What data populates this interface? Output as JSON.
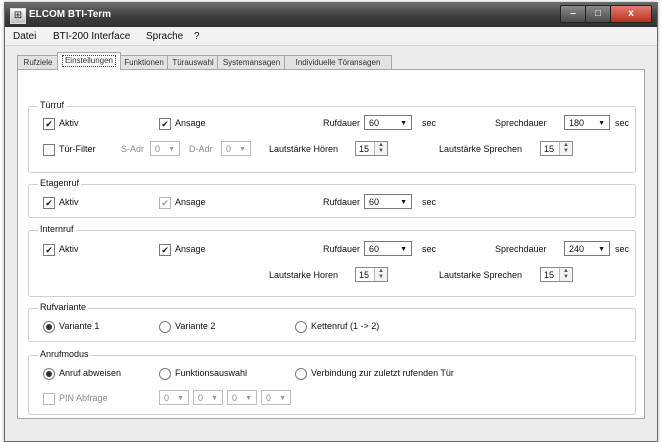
{
  "window": {
    "title": "ELCOM BTI-Term",
    "minimize": "–",
    "maximize": "□",
    "close": "x"
  },
  "menu": [
    "Datei",
    "BTI-200 Interface",
    "Sprache",
    "?"
  ],
  "tabs": [
    "Rufziele",
    "Einstellungen",
    "Funktionen",
    "Türauswahl",
    "Systemansagen",
    "Individuelle Töransagen"
  ],
  "active_tab": "Einstellungen",
  "tuerruf": {
    "title": "Türruf",
    "aktiv": "Aktiv",
    "ansage": "Ansage",
    "rufdauer_label": "Rufdauer",
    "rufdauer_value": "60",
    "rufdauer_unit": "sec",
    "sprechdauer_label": "Sprechdauer",
    "sprechdauer_value": "180",
    "sprechdauer_unit": "sec",
    "tuer_filter": "Tür-Filter",
    "s_adr_label": "S-Adr",
    "s_adr_value": "0",
    "d_adr_label": "D-Adr",
    "d_adr_value": "0",
    "lautstaerke_hoeren_label": "Lautstärke Hören",
    "lautstaerke_hoeren_value": "15",
    "lautstaerke_sprechen_label": "Lautstärke Sprechen",
    "lautstaerke_sprechen_value": "15"
  },
  "etagenruf": {
    "title": "Etagenruf",
    "aktiv": "Aktiv",
    "ansage": "Ansage",
    "rufdauer_label": "Rufdauer",
    "rufdauer_value": "60",
    "rufdauer_unit": "sec"
  },
  "internruf": {
    "title": "Internruf",
    "aktiv": "Aktiv",
    "ansage": "Ansage",
    "rufdauer_label": "Rufdauer",
    "rufdauer_value": "60",
    "rufdauer_unit": "sec",
    "sprechdauer_label": "Sprechdauer",
    "sprechdauer_value": "240",
    "sprechdauer_unit": "sec",
    "lautstaerke_hoeren_label": "Lautstarke Horen",
    "lautstaerke_hoeren_value": "15",
    "lautstaerke_sprechen_label": "Lautstarke Sprechen",
    "lautstaerke_sprechen_value": "15"
  },
  "rufvariante": {
    "title": "Rufvariante",
    "variante1": "Variante 1",
    "variante2": "Variante 2",
    "kettenruf": "Kettenruf (1 -> 2)",
    "selected": "Variante 1"
  },
  "anrufmodus": {
    "title": "Anrufmodus",
    "anruf_abweisen": "Anruf abweisen",
    "funktionsauswahl": "Funktionsauswahl",
    "verbindung": "Verbindung zur zuletzt rufenden Tür",
    "selected": "Anruf abweisen",
    "pin_abfrage": "PIN Abfrage",
    "pin_values": [
      "0",
      "0",
      "0",
      "0"
    ]
  },
  "icons": {
    "app": "app-icon",
    "dropdown": "chevron-down-icon",
    "spinner": "spinner-arrows-icon",
    "check": "checkmark-icon"
  }
}
